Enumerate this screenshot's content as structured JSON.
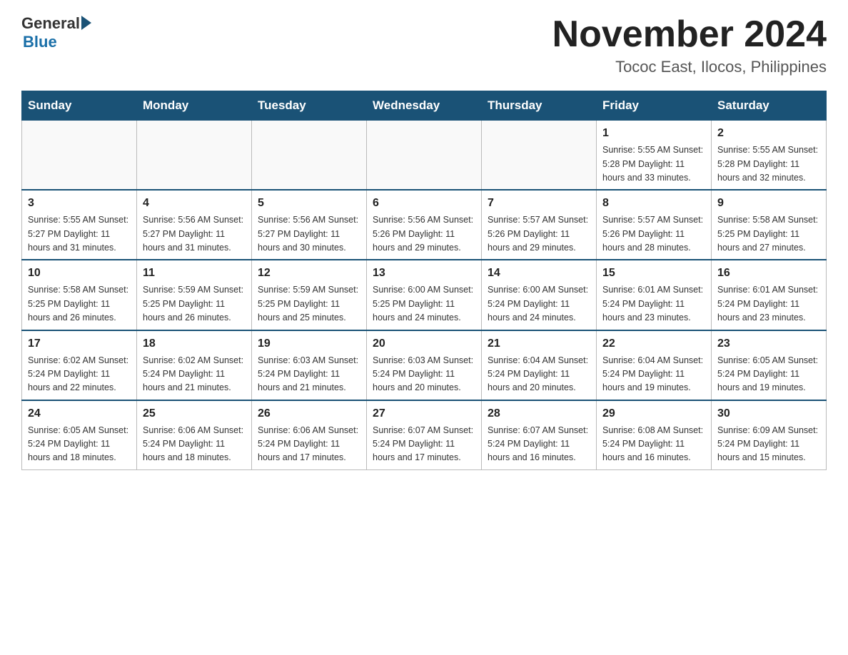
{
  "header": {
    "logo_general": "General",
    "logo_blue": "Blue",
    "title": "November 2024",
    "subtitle": "Tococ East, Ilocos, Philippines"
  },
  "weekdays": [
    "Sunday",
    "Monday",
    "Tuesday",
    "Wednesday",
    "Thursday",
    "Friday",
    "Saturday"
  ],
  "weeks": [
    [
      {
        "day": "",
        "info": ""
      },
      {
        "day": "",
        "info": ""
      },
      {
        "day": "",
        "info": ""
      },
      {
        "day": "",
        "info": ""
      },
      {
        "day": "",
        "info": ""
      },
      {
        "day": "1",
        "info": "Sunrise: 5:55 AM\nSunset: 5:28 PM\nDaylight: 11 hours\nand 33 minutes."
      },
      {
        "day": "2",
        "info": "Sunrise: 5:55 AM\nSunset: 5:28 PM\nDaylight: 11 hours\nand 32 minutes."
      }
    ],
    [
      {
        "day": "3",
        "info": "Sunrise: 5:55 AM\nSunset: 5:27 PM\nDaylight: 11 hours\nand 31 minutes."
      },
      {
        "day": "4",
        "info": "Sunrise: 5:56 AM\nSunset: 5:27 PM\nDaylight: 11 hours\nand 31 minutes."
      },
      {
        "day": "5",
        "info": "Sunrise: 5:56 AM\nSunset: 5:27 PM\nDaylight: 11 hours\nand 30 minutes."
      },
      {
        "day": "6",
        "info": "Sunrise: 5:56 AM\nSunset: 5:26 PM\nDaylight: 11 hours\nand 29 minutes."
      },
      {
        "day": "7",
        "info": "Sunrise: 5:57 AM\nSunset: 5:26 PM\nDaylight: 11 hours\nand 29 minutes."
      },
      {
        "day": "8",
        "info": "Sunrise: 5:57 AM\nSunset: 5:26 PM\nDaylight: 11 hours\nand 28 minutes."
      },
      {
        "day": "9",
        "info": "Sunrise: 5:58 AM\nSunset: 5:25 PM\nDaylight: 11 hours\nand 27 minutes."
      }
    ],
    [
      {
        "day": "10",
        "info": "Sunrise: 5:58 AM\nSunset: 5:25 PM\nDaylight: 11 hours\nand 26 minutes."
      },
      {
        "day": "11",
        "info": "Sunrise: 5:59 AM\nSunset: 5:25 PM\nDaylight: 11 hours\nand 26 minutes."
      },
      {
        "day": "12",
        "info": "Sunrise: 5:59 AM\nSunset: 5:25 PM\nDaylight: 11 hours\nand 25 minutes."
      },
      {
        "day": "13",
        "info": "Sunrise: 6:00 AM\nSunset: 5:25 PM\nDaylight: 11 hours\nand 24 minutes."
      },
      {
        "day": "14",
        "info": "Sunrise: 6:00 AM\nSunset: 5:24 PM\nDaylight: 11 hours\nand 24 minutes."
      },
      {
        "day": "15",
        "info": "Sunrise: 6:01 AM\nSunset: 5:24 PM\nDaylight: 11 hours\nand 23 minutes."
      },
      {
        "day": "16",
        "info": "Sunrise: 6:01 AM\nSunset: 5:24 PM\nDaylight: 11 hours\nand 23 minutes."
      }
    ],
    [
      {
        "day": "17",
        "info": "Sunrise: 6:02 AM\nSunset: 5:24 PM\nDaylight: 11 hours\nand 22 minutes."
      },
      {
        "day": "18",
        "info": "Sunrise: 6:02 AM\nSunset: 5:24 PM\nDaylight: 11 hours\nand 21 minutes."
      },
      {
        "day": "19",
        "info": "Sunrise: 6:03 AM\nSunset: 5:24 PM\nDaylight: 11 hours\nand 21 minutes."
      },
      {
        "day": "20",
        "info": "Sunrise: 6:03 AM\nSunset: 5:24 PM\nDaylight: 11 hours\nand 20 minutes."
      },
      {
        "day": "21",
        "info": "Sunrise: 6:04 AM\nSunset: 5:24 PM\nDaylight: 11 hours\nand 20 minutes."
      },
      {
        "day": "22",
        "info": "Sunrise: 6:04 AM\nSunset: 5:24 PM\nDaylight: 11 hours\nand 19 minutes."
      },
      {
        "day": "23",
        "info": "Sunrise: 6:05 AM\nSunset: 5:24 PM\nDaylight: 11 hours\nand 19 minutes."
      }
    ],
    [
      {
        "day": "24",
        "info": "Sunrise: 6:05 AM\nSunset: 5:24 PM\nDaylight: 11 hours\nand 18 minutes."
      },
      {
        "day": "25",
        "info": "Sunrise: 6:06 AM\nSunset: 5:24 PM\nDaylight: 11 hours\nand 18 minutes."
      },
      {
        "day": "26",
        "info": "Sunrise: 6:06 AM\nSunset: 5:24 PM\nDaylight: 11 hours\nand 17 minutes."
      },
      {
        "day": "27",
        "info": "Sunrise: 6:07 AM\nSunset: 5:24 PM\nDaylight: 11 hours\nand 17 minutes."
      },
      {
        "day": "28",
        "info": "Sunrise: 6:07 AM\nSunset: 5:24 PM\nDaylight: 11 hours\nand 16 minutes."
      },
      {
        "day": "29",
        "info": "Sunrise: 6:08 AM\nSunset: 5:24 PM\nDaylight: 11 hours\nand 16 minutes."
      },
      {
        "day": "30",
        "info": "Sunrise: 6:09 AM\nSunset: 5:24 PM\nDaylight: 11 hours\nand 15 minutes."
      }
    ]
  ]
}
